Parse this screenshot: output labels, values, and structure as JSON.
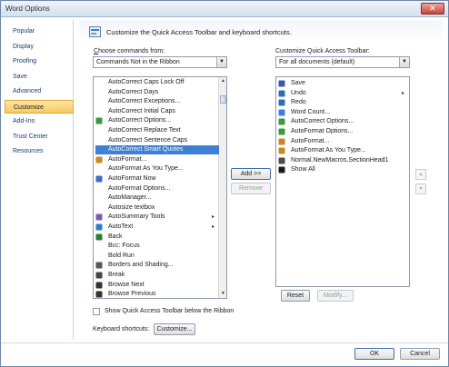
{
  "window": {
    "title": "Word Options",
    "close_symbol": "✕"
  },
  "sidebar": {
    "items": [
      {
        "label": "Popular",
        "selected": false
      },
      {
        "label": "Display",
        "selected": false
      },
      {
        "label": "Proofing",
        "selected": false
      },
      {
        "label": "Save",
        "selected": false
      },
      {
        "label": "Advanced",
        "selected": false
      },
      {
        "label": "Customize",
        "selected": true
      },
      {
        "label": "Add-Ins",
        "selected": false
      },
      {
        "label": "Trust Center",
        "selected": false
      },
      {
        "label": "Resources",
        "selected": false
      }
    ]
  },
  "header": {
    "text": "Customize the Quick Access Toolbar and keyboard shortcuts."
  },
  "choose": {
    "label": "Choose commands from:",
    "selected": "Commands Not in the Ribbon"
  },
  "customize_toolbar": {
    "label": "Customize Quick Access Toolbar:",
    "selected": "For all documents (default)"
  },
  "commands_list": [
    {
      "label": "AutoCorrect Caps Lock Off",
      "icon": "none",
      "submenu": false,
      "selected": false
    },
    {
      "label": "AutoCorrect Days",
      "icon": "none",
      "submenu": false,
      "selected": false
    },
    {
      "label": "AutoCorrect Exceptions...",
      "icon": "none",
      "submenu": false,
      "selected": false
    },
    {
      "label": "AutoCorrect Initial Caps",
      "icon": "none",
      "submenu": false,
      "selected": false
    },
    {
      "label": "AutoCorrect Options...",
      "icon": "autocorrect-icon",
      "submenu": false,
      "selected": false
    },
    {
      "label": "AutoCorrect Replace Text",
      "icon": "none",
      "submenu": false,
      "selected": false
    },
    {
      "label": "AutoCorrect Sentence Caps",
      "icon": "none",
      "submenu": false,
      "selected": false
    },
    {
      "label": "AutoCorrect Smart Quotes",
      "icon": "none",
      "submenu": false,
      "selected": true
    },
    {
      "label": "AutoFormat...",
      "icon": "autoformat-icon",
      "submenu": false,
      "selected": false
    },
    {
      "label": "AutoFormat As You Type...",
      "icon": "none",
      "submenu": false,
      "selected": false
    },
    {
      "label": "AutoFormat Now",
      "icon": "autoformat-now-icon",
      "submenu": false,
      "selected": false
    },
    {
      "label": "AutoFormat Options...",
      "icon": "none",
      "submenu": false,
      "selected": false
    },
    {
      "label": "AutoManager...",
      "icon": "none",
      "submenu": false,
      "selected": false
    },
    {
      "label": "Autosize textbox",
      "icon": "none",
      "submenu": false,
      "selected": false
    },
    {
      "label": "AutoSummary Tools",
      "icon": "autosummary-icon",
      "submenu": true,
      "selected": false
    },
    {
      "label": "AutoText",
      "icon": "autotext-icon",
      "submenu": true,
      "selected": false
    },
    {
      "label": "Back",
      "icon": "back-icon",
      "submenu": false,
      "selected": false
    },
    {
      "label": "Bcc: Focus",
      "icon": "none",
      "submenu": false,
      "selected": false
    },
    {
      "label": "Bold Run",
      "icon": "none",
      "submenu": false,
      "selected": false
    },
    {
      "label": "Borders and Shading...",
      "icon": "borders-icon",
      "submenu": false,
      "selected": false
    },
    {
      "label": "Break",
      "icon": "break-icon",
      "submenu": false,
      "selected": false
    },
    {
      "label": "Browse Next",
      "icon": "browse-next-icon",
      "submenu": false,
      "selected": false
    },
    {
      "label": "Browse Previous",
      "icon": "browse-previous-icon",
      "submenu": false,
      "selected": false
    }
  ],
  "toolbar_list": [
    {
      "label": "Save",
      "icon": "save-icon",
      "submenu": false
    },
    {
      "label": "Undo",
      "icon": "undo-icon",
      "submenu": true
    },
    {
      "label": "Redo",
      "icon": "redo-icon",
      "submenu": false
    },
    {
      "label": "Word Count...",
      "icon": "word-count-icon",
      "submenu": false
    },
    {
      "label": "AutoCorrect Options...",
      "icon": "autocorrect-icon",
      "submenu": false
    },
    {
      "label": "AutoFormat Options...",
      "icon": "autoformat-options-icon",
      "submenu": false
    },
    {
      "label": "AutoFormat...",
      "icon": "autoformat-icon",
      "submenu": false
    },
    {
      "label": "AutoFormat As You Type...",
      "icon": "autoformat-type-icon",
      "submenu": false
    },
    {
      "label": "Normal.NewMacros.SectionHead1",
      "icon": "macro-icon",
      "submenu": false
    },
    {
      "label": "Show All",
      "icon": "show-all-icon",
      "submenu": false
    }
  ],
  "buttons": {
    "add": "Add >>",
    "remove": "Remove",
    "reset": "Reset",
    "modify": "Modify...",
    "customize": "Customize...",
    "ok": "OK",
    "cancel": "Cancel"
  },
  "show_below_ribbon": {
    "label": "Show Quick Access Toolbar below the Ribbon",
    "checked": false
  },
  "keyboard_shortcuts": {
    "label": "Keyboard shortcuts:"
  },
  "colors": {
    "selection": "#3f7fd4",
    "nav_selected": "#f8c860"
  }
}
